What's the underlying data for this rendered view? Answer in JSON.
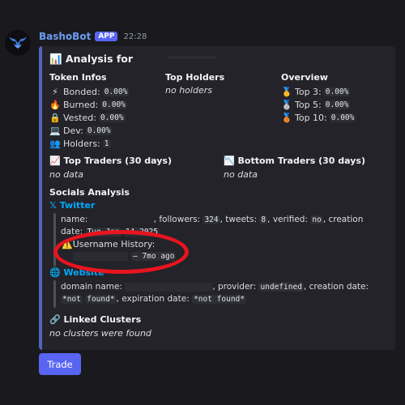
{
  "message": {
    "bot_name": "BashoBot",
    "app_tag": "APP",
    "time": "22:28"
  },
  "embed": {
    "title": "📊 Analysis for",
    "token_infos": {
      "heading": "Token Infos",
      "items": [
        {
          "icon": "⚡",
          "label": "Bonded:",
          "value": "0.00%"
        },
        {
          "icon": "🔥",
          "label": "Burned:",
          "value": "0.00%"
        },
        {
          "icon": "🔒",
          "label": "Vested:",
          "value": "0.00%"
        },
        {
          "icon": "💻",
          "label": "Dev:",
          "value": "0.00%"
        },
        {
          "icon": "👥",
          "label": "Holders:",
          "value": "1"
        }
      ]
    },
    "top_holders": {
      "heading": "Top Holders",
      "text": "no holders"
    },
    "overview": {
      "heading": "Overview",
      "items": [
        {
          "icon": "🥇",
          "label": "Top 3:",
          "value": "0.00%"
        },
        {
          "icon": "🥈",
          "label": "Top 5:",
          "value": "0.00%"
        },
        {
          "icon": "🥉",
          "label": "Top 10:",
          "value": "0.00%"
        }
      ]
    },
    "top_traders": {
      "heading": "📈 Top Traders (30 days)",
      "text": "no data"
    },
    "bottom_traders": {
      "heading": "📉 Bottom Traders (30 days)",
      "text": "no data"
    },
    "socials": {
      "heading": "Socials Analysis",
      "twitter": {
        "label": "𝕏 Twitter",
        "name_label": "name:",
        "followers_label": ", followers:",
        "followers": "324",
        "tweets_label": ", tweets:",
        "tweets": "8",
        "verified_label": ", verified:",
        "verified": "no",
        "creation_label": ", creation date:",
        "creation_date": "Tue Jan",
        "creation_date_cont": "14 2025",
        "history_label": "⚠️Username History:",
        "history_entry": "– 7mo ago"
      },
      "website": {
        "label": "🌐 Website",
        "domain_label": "domain name:",
        "provider_label": ", provider:",
        "provider": "undefined",
        "creation_label": ", creation date:",
        "creation_date": "*not",
        "creation_date_cont": "found*",
        "expiration_label": ", expiration date:",
        "expiration_date": "*not found*"
      }
    },
    "linked_clusters": {
      "heading": "🔗 Linked Clusters",
      "text": "no clusters were found"
    }
  },
  "buttons": {
    "trade": "Trade"
  },
  "colors": {
    "accent": "#5865f2",
    "embed_border": "#4f66c0",
    "annotation": "#e8141f",
    "link": "#00a8fc"
  }
}
